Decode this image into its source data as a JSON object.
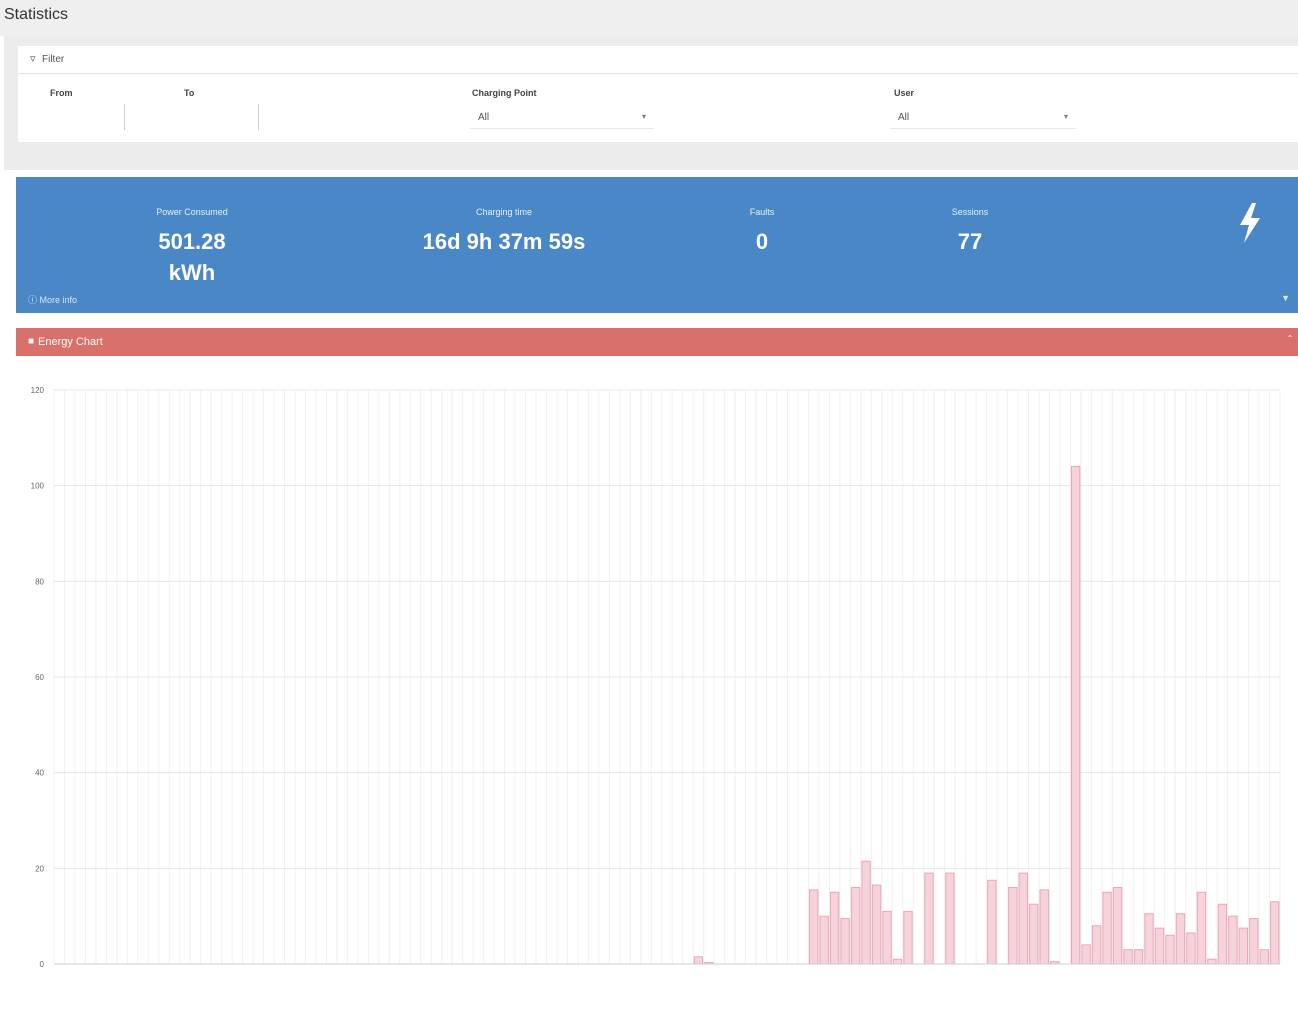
{
  "page": {
    "title": "Statistics"
  },
  "filter": {
    "header_label": "Filter",
    "from_label": "From",
    "to_label": "To",
    "from_value": "",
    "to_value": "",
    "charging_point_label": "Charging Point",
    "charging_point_value": "All",
    "user_label": "User",
    "user_value": "All"
  },
  "summary": {
    "power_label": "Power Consumed",
    "power_value_number": "501.28",
    "power_value_unit": "kWh",
    "charging_time_label": "Charging time",
    "charging_time_value": "16d 9h 37m 59s",
    "faults_label": "Faults",
    "faults_value": "0",
    "sessions_label": "Sessions",
    "sessions_value": "77",
    "more_info_label": "More info",
    "icon": "bolt-icon",
    "color": "#4a87c6"
  },
  "chart_panel": {
    "title": "Energy Chart",
    "header_color": "#d9706c"
  },
  "chart_data": {
    "type": "bar",
    "title": "",
    "ylim": [
      0,
      120
    ],
    "y_ticks": [
      "0",
      "20",
      "40",
      "60",
      "80",
      "100",
      "120"
    ],
    "grid": true,
    "bar_color": "#f6d3da",
    "bar_stroke": "#e8a8b6",
    "values": [
      0,
      0,
      0,
      0,
      0,
      0,
      0,
      0,
      0,
      0,
      0,
      0,
      0,
      0,
      0,
      0,
      0,
      0,
      0,
      0,
      0,
      0,
      0,
      0,
      0,
      0,
      0,
      0,
      0,
      0,
      0,
      0,
      0,
      0,
      0,
      0,
      0,
      0,
      0,
      0,
      0,
      0,
      0,
      0,
      0,
      0,
      0,
      0,
      0,
      0,
      0,
      0,
      0,
      0,
      0,
      0,
      0,
      0,
      0,
      0,
      0,
      1.5,
      0.3,
      0,
      0,
      0,
      0,
      0,
      0,
      0,
      0,
      0,
      15.5,
      10,
      15,
      9.5,
      16,
      21.5,
      16.5,
      11,
      1,
      11,
      0,
      19,
      0,
      19,
      0,
      0,
      0,
      17.5,
      0,
      16,
      19,
      12.5,
      15.5,
      0.5,
      0,
      104,
      4,
      8,
      15,
      16,
      3,
      3,
      10.5,
      7.5,
      6,
      10.5,
      6.5,
      15,
      1,
      12.5,
      10,
      7.5,
      9.5,
      3,
      13
    ]
  }
}
